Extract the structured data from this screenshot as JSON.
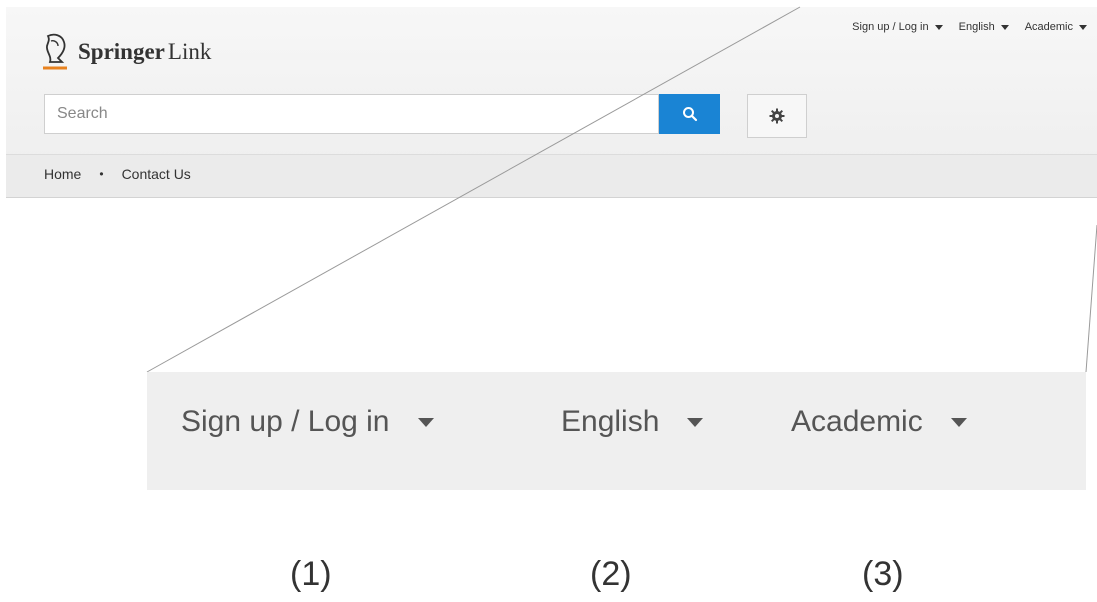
{
  "header": {
    "logo": {
      "brand": "Springer",
      "product": "Link"
    },
    "top_links": [
      {
        "label": "Sign up / Log in"
      },
      {
        "label": "English"
      },
      {
        "label": "Academic"
      }
    ],
    "search": {
      "placeholder": "Search"
    },
    "breadcrumb": {
      "home": "Home",
      "separator": "•",
      "contact": "Contact Us"
    }
  },
  "zoom": {
    "items": [
      {
        "label": "Sign up / Log in"
      },
      {
        "label": "English"
      },
      {
        "label": "Academic"
      }
    ],
    "numbers": [
      "(1)",
      "(2)",
      "(3)"
    ]
  },
  "colors": {
    "accent": "#1a84d4",
    "logo_underline": "#e8821f"
  }
}
